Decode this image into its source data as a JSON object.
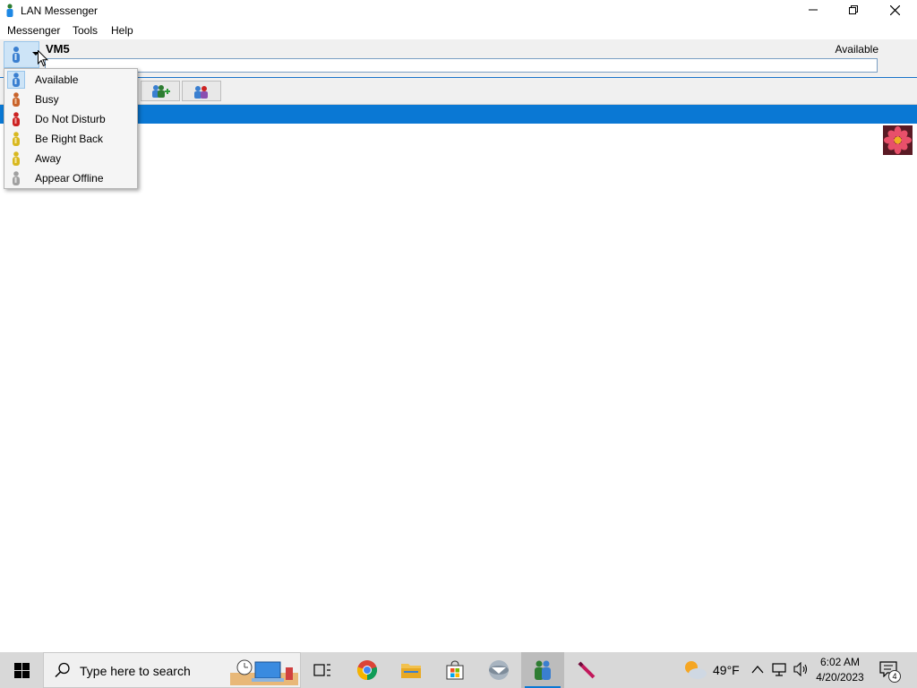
{
  "window": {
    "title": "LAN Messenger"
  },
  "menu": {
    "items": [
      "Messenger",
      "Tools",
      "Help"
    ]
  },
  "header": {
    "user_name": "VM5",
    "status_text": "Available",
    "note_value": ""
  },
  "status_menu": {
    "items": [
      {
        "label": "Available",
        "color": "#3a7fd0",
        "selected": true
      },
      {
        "label": "Busy",
        "color": "#c8622a"
      },
      {
        "label": "Do Not Disturb",
        "color": "#cc2222"
      },
      {
        "label": "Be Right Back",
        "color": "#d8b820"
      },
      {
        "label": "Away",
        "color": "#d8b820"
      },
      {
        "label": "Appear Offline",
        "color": "#a0a0a0"
      }
    ]
  },
  "toolbar": {
    "buttons": [
      {
        "icon": "add-contact-icon"
      },
      {
        "icon": "broadcast-icon"
      }
    ]
  },
  "taskbar": {
    "search_placeholder": "Type here to search",
    "weather_temp": "49°F",
    "time": "6:02 AM",
    "date": "4/20/2023",
    "notification_count": "4"
  },
  "colors": {
    "accent": "#0a78d4",
    "taskbar": "#d8d8d8"
  }
}
